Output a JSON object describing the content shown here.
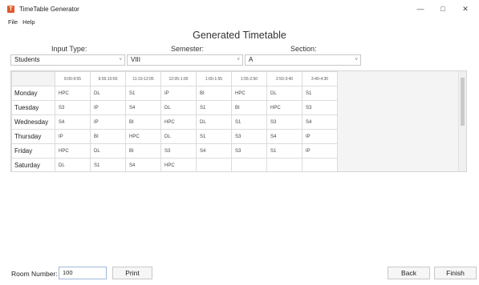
{
  "window": {
    "title": "TimeTable Generator",
    "icon": "app-logo-icon",
    "controls": [
      "minimize-icon",
      "maximize-icon",
      "close-icon"
    ]
  },
  "menu": {
    "items": [
      "File",
      "Help"
    ]
  },
  "heading": "Generated Timetable",
  "filters": {
    "input_type_label": "Input Type:",
    "semester_label": "Semester:",
    "section_label": "Section:",
    "input_type_value": "Students",
    "semester_value": "VIII",
    "section_value": "A"
  },
  "timetable": {
    "times": [
      "9:00-9:55",
      "9:55-10:50",
      "11:10-12:05",
      "12:05-1:00",
      "1:00-1:55",
      "1:55-2:50",
      "2:50-3:40",
      "3:40-4:30"
    ],
    "days": [
      {
        "day": "Monday",
        "cells": [
          "HPC",
          "DL",
          "S1",
          "IP",
          "BI",
          "HPC",
          "DL",
          "S1"
        ]
      },
      {
        "day": "Tuesday",
        "cells": [
          "S3",
          "IP",
          "S4",
          "DL",
          "S1",
          "BI",
          "HPC",
          "S3"
        ]
      },
      {
        "day": "Wednesday",
        "cells": [
          "S4",
          "IP",
          "BI",
          "HPC",
          "DL",
          "S1",
          "S3",
          "S4"
        ]
      },
      {
        "day": "Thursday",
        "cells": [
          "IP",
          "BI",
          "HPC",
          "DL",
          "S1",
          "S3",
          "S4",
          "IP"
        ]
      },
      {
        "day": "Friday",
        "cells": [
          "HPC",
          "DL",
          "BI",
          "S3",
          "S4",
          "S3",
          "S1",
          "IP"
        ]
      },
      {
        "day": "Saturday",
        "cells": [
          "DL",
          "S1",
          "S4",
          "HPC",
          "",
          "",
          "",
          ""
        ]
      }
    ]
  },
  "footer": {
    "room_label": "Room Number:",
    "room_value": "100",
    "print_label": "Print",
    "back_label": "Back",
    "finish_label": "Finish"
  }
}
